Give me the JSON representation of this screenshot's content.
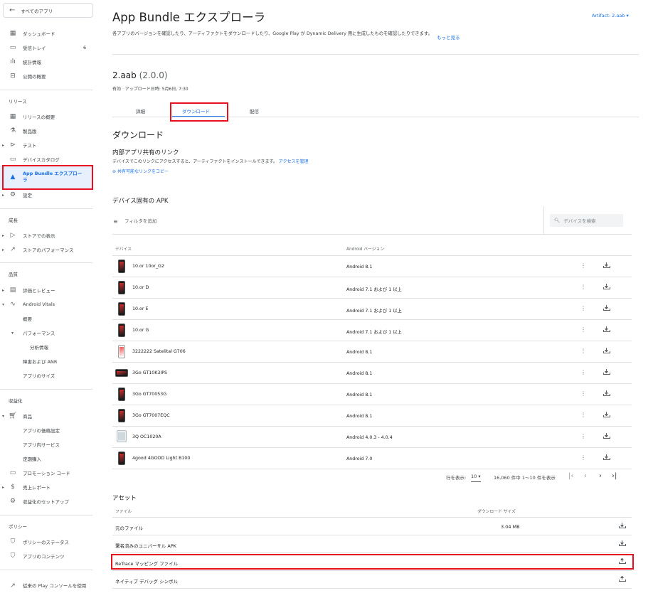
{
  "sidebar": {
    "back_label": "すべてのアプリ",
    "items": [
      {
        "label": "ダッシュボード",
        "icon": "dashboard-icon"
      },
      {
        "label": "受信トレイ",
        "badge": "6",
        "icon": "inbox-icon"
      },
      {
        "label": "統計情報",
        "icon": "bar-chart-icon"
      },
      {
        "label": "公開の概要",
        "icon": "publishing-icon"
      }
    ],
    "section_release": "リリース",
    "release_items": [
      {
        "label": "リリースの概要",
        "icon": "grid-icon"
      },
      {
        "label": "製品版",
        "icon": "flask-icon"
      },
      {
        "label": "テスト",
        "icon": "play-circle-icon"
      },
      {
        "label": "デバイスカタログ",
        "icon": "devices-icon"
      },
      {
        "label": "App Bundle エクスプローラ",
        "icon": "android-icon"
      },
      {
        "label": "設定",
        "icon": "gear-icon"
      }
    ],
    "section_growth": "成長",
    "growth_items": [
      {
        "label": "ストアでの表示",
        "icon": "store-icon"
      },
      {
        "label": "ストアのパフォーマンス",
        "icon": "trending-icon"
      }
    ],
    "section_quality": "品質",
    "quality_items": [
      {
        "label": "評価とレビュー",
        "icon": "reviews-icon"
      },
      {
        "label": "Android Vitals",
        "icon": "vitals-icon"
      },
      {
        "label": "概要"
      },
      {
        "label": "パフォーマンス"
      },
      {
        "label": "分析情報"
      },
      {
        "label": "障害および ANR"
      },
      {
        "label": "アプリのサイズ"
      }
    ],
    "section_monetize": "収益化",
    "monetize_items": [
      {
        "label": "商品",
        "icon": "cart-icon"
      },
      {
        "label": "アプリの価格設定"
      },
      {
        "label": "アプリ内サービス"
      },
      {
        "label": "定期購入"
      },
      {
        "label": "プロモーション コード",
        "icon": "promo-icon"
      },
      {
        "label": "売上レポート",
        "icon": "dollar-icon"
      },
      {
        "label": "収益化のセットアップ",
        "icon": "gear-icon"
      }
    ],
    "section_policy": "ポリシー",
    "policy_items": [
      {
        "label": "ポリシーのステータス",
        "icon": "shield-icon"
      },
      {
        "label": "アプリのコンテンツ",
        "icon": "shield-icon"
      }
    ],
    "legacy_label": "従来の Play コンソールを使用"
  },
  "header": {
    "title": "App Bundle エクスプローラ",
    "artifact": "Artifact: 2.aab",
    "description": "各アプリのバージョンを確認したり、アーティファクトをダウンロードしたり、Google Play が Dynamic Delivery 用に生成したものを確認したりできます。",
    "more_link": "もっと見る"
  },
  "bundle": {
    "name": "2.aab",
    "version": "(2.0.0)",
    "status": "有効",
    "uploaded": "アップロード日時: 5月6日, 7:30"
  },
  "tabs": [
    "詳細",
    "ダウンロード",
    "配信"
  ],
  "download": {
    "heading": "ダウンロード",
    "internal_share_title": "内部アプリ共有のリンク",
    "internal_share_desc": "デバイスでこのリンクにアクセスすると、アーティファクトをインストールできます。",
    "manage_access": "アクセスを管理",
    "copy_link": "共有可能なリンクをコピー"
  },
  "devices": {
    "heading": "デバイス固有の APK",
    "filter_label": "フィルタを追加",
    "search_placeholder": "デバイスを検索",
    "col_device": "デバイス",
    "col_android": "Android バージョン",
    "rows": [
      {
        "name": "10.or 10or_G2",
        "android": "Android 8.1",
        "img": "phone"
      },
      {
        "name": "10.or D",
        "android": "Android 7.1 および 1 以上",
        "img": "phone"
      },
      {
        "name": "10.or E",
        "android": "Android 7.1 および 1 以上",
        "img": "phone"
      },
      {
        "name": "10.or G",
        "android": "Android 7.1 および 1 以上",
        "img": "phone"
      },
      {
        "name": "3222222 Satelital G706",
        "android": "Android 8.1",
        "img": "light"
      },
      {
        "name": "3Go GT10K3IPS",
        "android": "Android 8.1",
        "img": "wide"
      },
      {
        "name": "3Go GT70053G",
        "android": "Android 8.1",
        "img": "phone"
      },
      {
        "name": "3Go GT7007EQC",
        "android": "Android 8.1",
        "img": "phone"
      },
      {
        "name": "3Q OC1020A",
        "android": "Android 4.0.3 - 4.0.4",
        "img": "tablet"
      },
      {
        "name": "4good 4GOOD Light B100",
        "android": "Android 7.0",
        "img": "phone"
      }
    ],
    "pager": {
      "rows_label": "行を表示:",
      "rows_value": "10",
      "range": "16,060 件中 1～10 件を表示"
    }
  },
  "assets": {
    "heading": "アセット",
    "col_file": "ファイル",
    "col_size": "ダウンロード サイズ",
    "rows": [
      {
        "name": "元のファイル",
        "size": "3.04 MB",
        "action": "download"
      },
      {
        "name": "署名済みのユニバーサル APK",
        "size": "",
        "action": "download"
      },
      {
        "name": "ReTrace マッピング ファイル",
        "size": "",
        "action": "upload"
      },
      {
        "name": "ネイティブ デバッグ シンボル",
        "size": "",
        "action": "upload"
      }
    ]
  },
  "colors": {
    "accent": "#1a73e8",
    "highlight": "#e8101e",
    "active_bg": "#e8f0fe"
  }
}
